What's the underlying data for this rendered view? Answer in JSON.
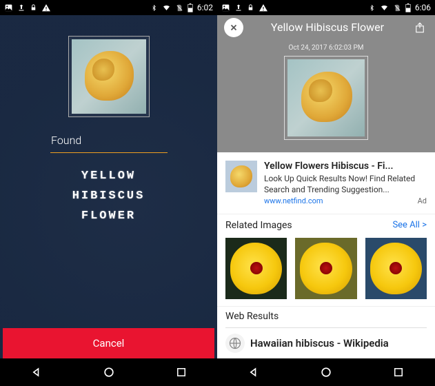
{
  "left": {
    "status": {
      "time": "6:02"
    },
    "found_label": "Found",
    "result_text": "YELLOW\nHIBISCUS\nFLOWER",
    "cancel_label": "Cancel"
  },
  "right": {
    "status": {
      "time": "6:06"
    },
    "title": "Yellow Hibiscus Flower",
    "date": "Oct 24, 2017 6:02:03 PM",
    "ad": {
      "title": "Yellow Flowers Hibiscus - Fi...",
      "desc": "Look Up Quick Results Now! Find Related Search and Trending Suggestion...",
      "url": "www.netfind.com",
      "tag": "Ad"
    },
    "related": {
      "title": "Related Images",
      "see_all": "See All >"
    },
    "web": {
      "title": "Web Results",
      "result1": "Hawaiian hibiscus - Wikipedia"
    }
  }
}
